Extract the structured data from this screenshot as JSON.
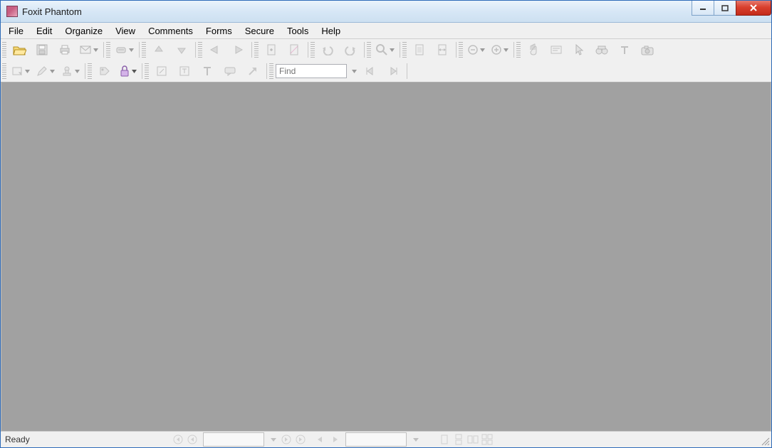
{
  "window": {
    "title": "Foxit Phantom"
  },
  "menu": {
    "items": [
      "File",
      "Edit",
      "Organize",
      "View",
      "Comments",
      "Forms",
      "Secure",
      "Tools",
      "Help"
    ]
  },
  "find": {
    "placeholder": "Find"
  },
  "status": {
    "text": "Ready"
  }
}
